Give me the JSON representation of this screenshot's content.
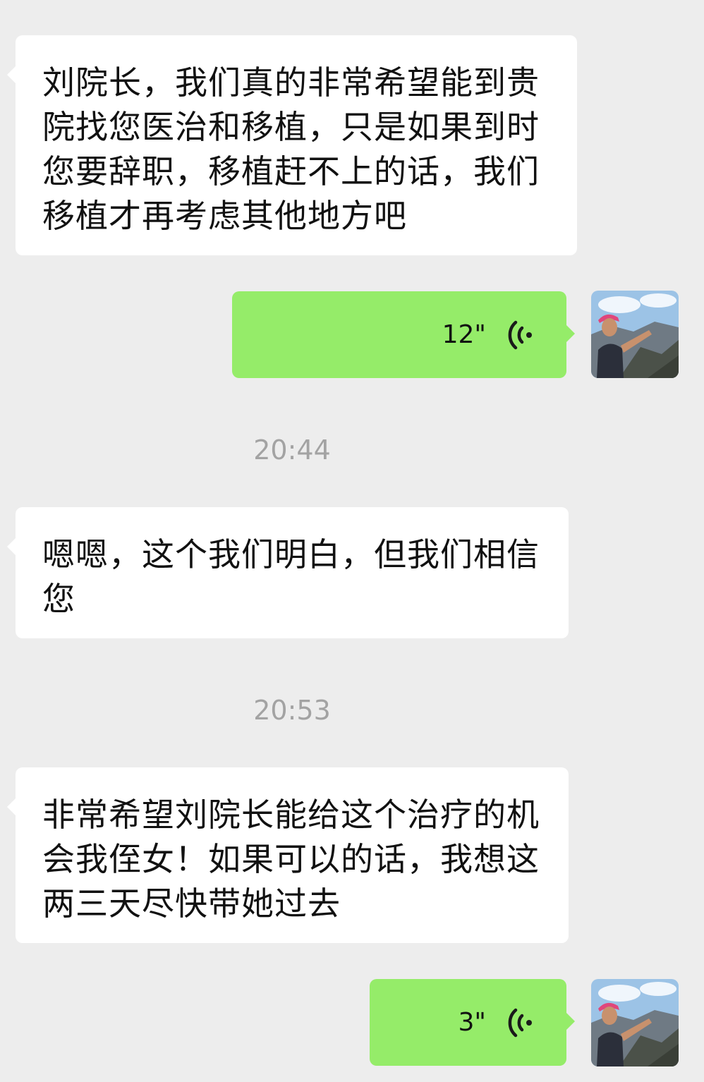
{
  "messages": [
    {
      "type": "text",
      "side": "in",
      "text": "刘院长，我们真的非常希望能到贵院找您医治和移植，只是如果到时您要辞职，移植赶不上的话，我们移植才再考虑其他地方吧"
    },
    {
      "type": "voice",
      "side": "out",
      "duration": "12\"",
      "icon": "voice-wave-icon"
    },
    {
      "type": "timestamp",
      "text": "20:44"
    },
    {
      "type": "text",
      "side": "in",
      "text": "嗯嗯，这个我们明白，但我们相信您"
    },
    {
      "type": "timestamp",
      "text": "20:53"
    },
    {
      "type": "text",
      "side": "in",
      "text": "非常希望刘院长能给这个治疗的机会我侄女！如果可以的话，我想这两三天尽快带她过去"
    },
    {
      "type": "voice",
      "side": "out",
      "duration": "3\"",
      "icon": "voice-wave-icon"
    }
  ],
  "colors": {
    "background": "#ededed",
    "incoming_bubble": "#ffffff",
    "outgoing_bubble": "#95ec69",
    "timestamp_text": "#a3a3a3"
  }
}
